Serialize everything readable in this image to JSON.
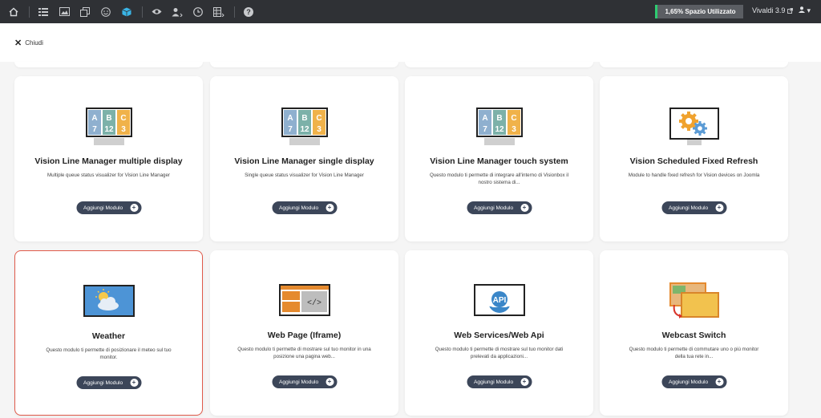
{
  "topbar": {
    "icons": [
      "home-icon",
      "list-icon",
      "image-icon",
      "copy-icon",
      "smile-icon",
      "cube-icon",
      "eye-icon",
      "user-settings-icon",
      "clock-icon",
      "grid-icon",
      "help-icon"
    ],
    "storage": "1,65% Spazio Utilizzato",
    "version": "Vivaldi 3.9",
    "user_caret": "▾"
  },
  "header": {
    "close_label": "Chiudi"
  },
  "colors": {
    "accent": "#3ab5e6",
    "button": "#3c4659",
    "selected_border": "#e05a4a",
    "storage_bar": "#2ecc71"
  },
  "cards": [
    {
      "title": "Vision Line Manager multiple display",
      "desc": "Multiple queue status visualizer for Vision Line Manager",
      "button": "Aggiungi Modulo",
      "icon": "abc-monitor-icon"
    },
    {
      "title": "Vision Line Manager single display",
      "desc": "Single queue status visualizer for Vision Line Manager",
      "button": "Aggiungi Modulo",
      "icon": "abc-monitor-icon"
    },
    {
      "title": "Vision Line Manager touch system",
      "desc": "Questo modulo ti permette di integrare all'interno di Visionbox il nostro sistema di...",
      "button": "Aggiungi Modulo",
      "icon": "abc-monitor-icon"
    },
    {
      "title": "Vision Scheduled Fixed Refresh",
      "desc": "Module to handle fixed refresh for Vision devices on Joomla",
      "button": "Aggiungi Modulo",
      "icon": "gears-monitor-icon"
    },
    {
      "title": "Weather",
      "desc": "Questo modulo ti permette di posizionare il meteo sul tuo monitor.",
      "button": "Aggiungi Modulo",
      "icon": "weather-monitor-icon"
    },
    {
      "title": "Web Page (Iframe)",
      "desc": "Questo modulo ti permette di mostrare sul tuo monitor in una posizione una pagina web...",
      "button": "Aggiungi Modulo",
      "icon": "code-monitor-icon"
    },
    {
      "title": "Web Services/Web Api",
      "desc": "Questo modulo ti permette di mostrare sul tuo monitor dati prelevati da applicazioni...",
      "button": "Aggiungi Modulo",
      "icon": "api-monitor-icon"
    },
    {
      "title": "Webcast Switch",
      "desc": "Questo modulo ti permette di commutare uno o più monitor della tua rete in...",
      "button": "Aggiungi Modulo",
      "icon": "switch-screens-icon"
    }
  ],
  "abc": {
    "a": "A",
    "b": "B",
    "c": "C",
    "n7": "7",
    "n12": "12",
    "n3": "3"
  },
  "api_label": "API",
  "code_label": "</>"
}
